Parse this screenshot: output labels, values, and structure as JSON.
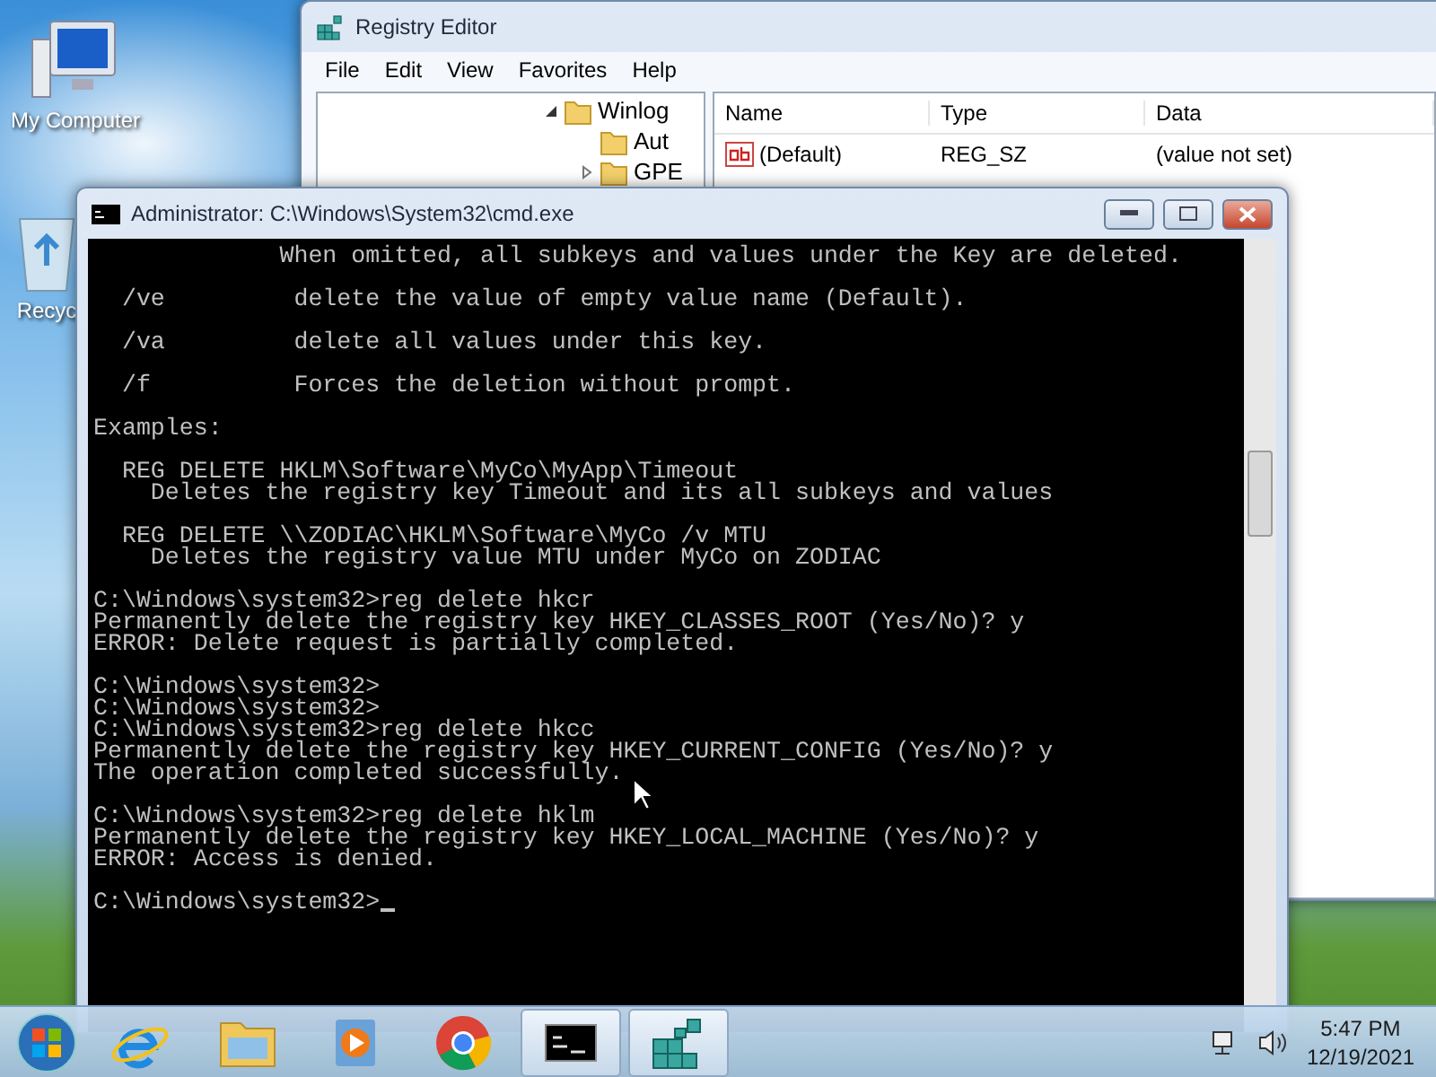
{
  "desktop_icons": [
    {
      "kind": "computer",
      "label": "My Computer"
    },
    {
      "kind": "recycle-bin",
      "label": "Recyc"
    }
  ],
  "registry_editor": {
    "title": "Registry Editor",
    "menu": [
      "File",
      "Edit",
      "View",
      "Favorites",
      "Help"
    ],
    "tree": [
      {
        "label": "Winlog",
        "expanded": true,
        "children": [
          {
            "label": "Aut"
          },
          {
            "label": "GPE",
            "expanded": false
          }
        ]
      }
    ],
    "columns": [
      "Name",
      "Type",
      "Data"
    ],
    "rows": [
      {
        "name": "(Default)",
        "type": "REG_SZ",
        "data": "(value not set)"
      }
    ]
  },
  "console": {
    "title": "Administrator: C:\\Windows\\System32\\cmd.exe",
    "blocks": [
      [
        "             When omitted, all subkeys and values under the Key are deleted."
      ],
      [
        "  /ve         delete the value of empty value name (Default)."
      ],
      [
        "  /va         delete all values under this key."
      ],
      [
        "  /f          Forces the deletion without prompt."
      ],
      [
        "Examples:"
      ],
      [
        "  REG DELETE HKLM\\Software\\MyCo\\MyApp\\Timeout",
        "    Deletes the registry key Timeout and its all subkeys and values"
      ],
      [
        "  REG DELETE \\\\ZODIAC\\HKLM\\Software\\MyCo /v MTU",
        "    Deletes the registry value MTU under MyCo on ZODIAC"
      ],
      [
        "C:\\Windows\\system32>reg delete hkcr",
        "Permanently delete the registry key HKEY_CLASSES_ROOT (Yes/No)? y",
        "ERROR: Delete request is partially completed."
      ],
      [
        "C:\\Windows\\system32>",
        "C:\\Windows\\system32>",
        "C:\\Windows\\system32>reg delete hkcc",
        "Permanently delete the registry key HKEY_CURRENT_CONFIG (Yes/No)? y",
        "The operation completed successfully."
      ],
      [
        "C:\\Windows\\system32>reg delete hklm",
        "Permanently delete the registry key HKEY_LOCAL_MACHINE (Yes/No)? y",
        "ERROR: Access is denied."
      ],
      [
        "C:\\Windows\\system32>"
      ]
    ]
  },
  "taskbar": {
    "items": [
      {
        "kind": "ie",
        "running": false
      },
      {
        "kind": "folder",
        "running": false
      },
      {
        "kind": "media",
        "running": false
      },
      {
        "kind": "chrome",
        "running": false
      },
      {
        "kind": "terminal",
        "running": true
      },
      {
        "kind": "cubes",
        "running": true
      }
    ],
    "clock": {
      "time": "5:47 PM",
      "date": "12/19/2021"
    }
  }
}
